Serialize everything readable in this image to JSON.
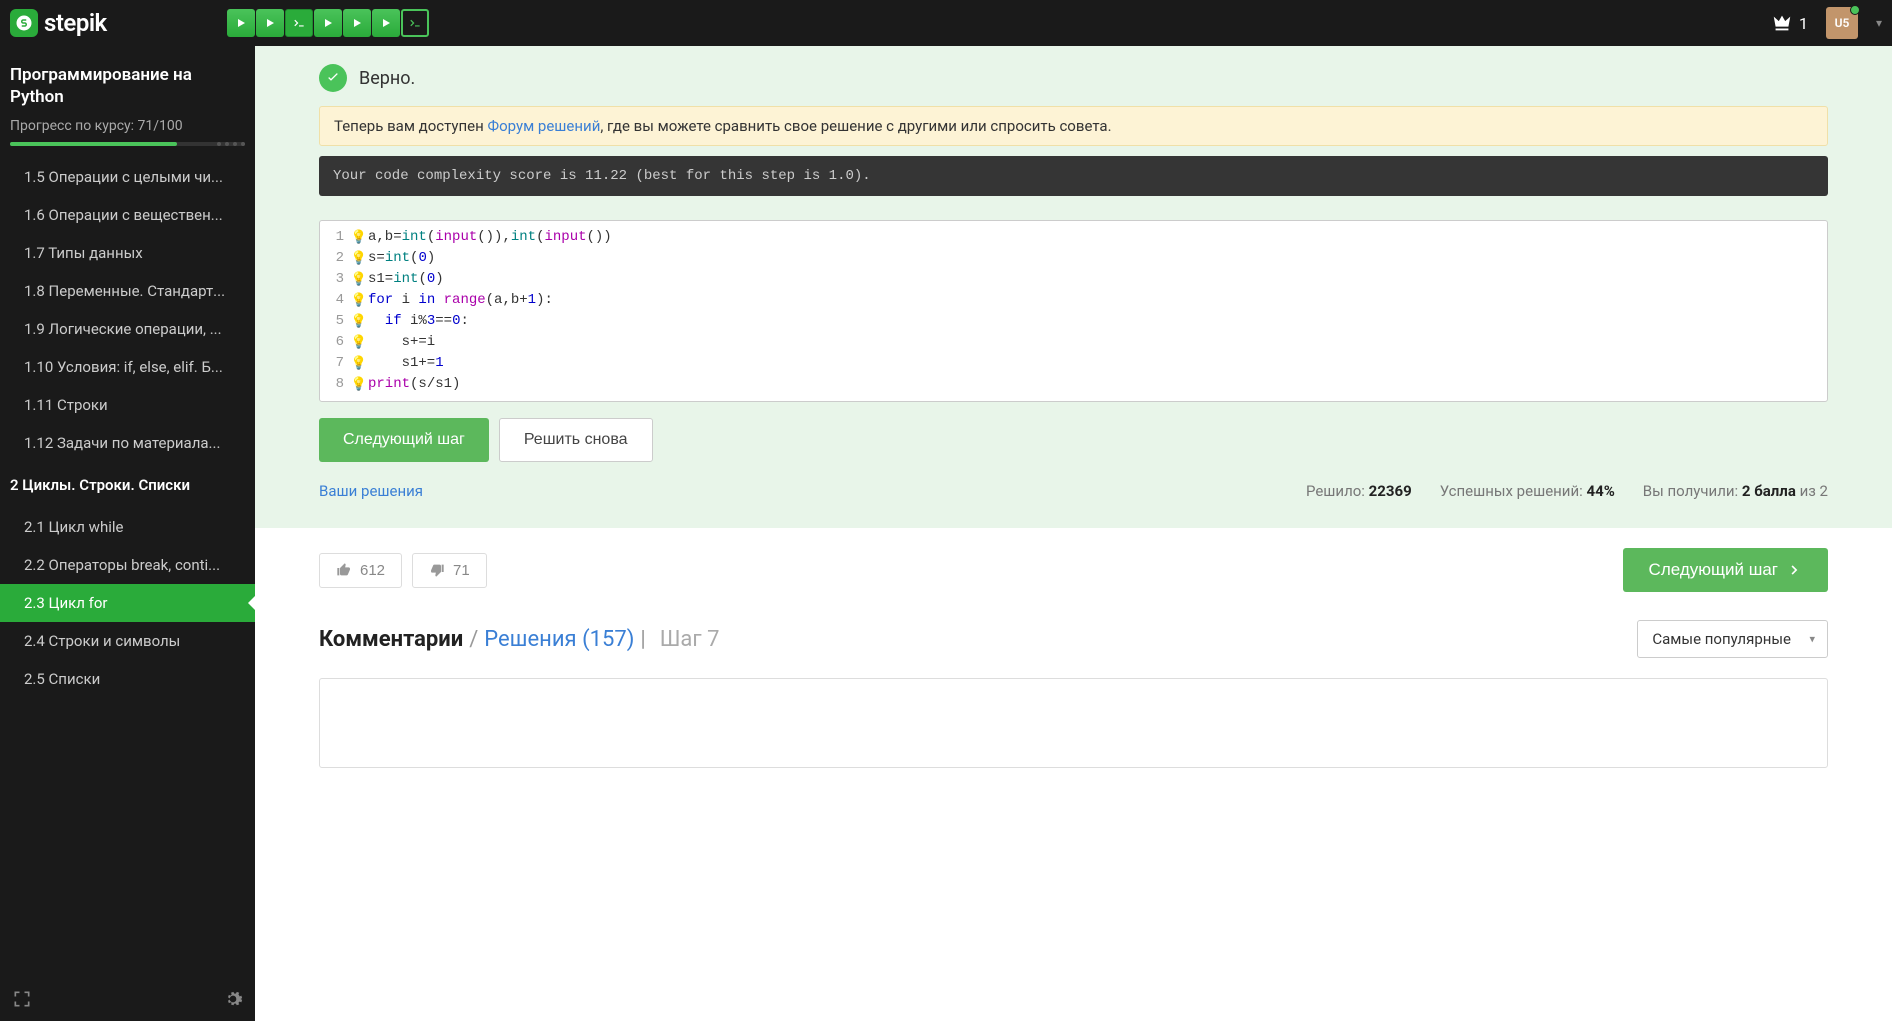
{
  "header": {
    "logo_text": "stepik",
    "crown_count": "1",
    "avatar_text": "U5",
    "steps": [
      {
        "type": "play"
      },
      {
        "type": "play"
      },
      {
        "type": "code"
      },
      {
        "type": "play"
      },
      {
        "type": "play"
      },
      {
        "type": "play"
      },
      {
        "type": "code-active"
      }
    ]
  },
  "sidebar": {
    "course_title": "Программирование на Python",
    "progress_label": "Прогресс по курсу:  71/100",
    "items1": [
      {
        "num": "1.5",
        "label": "Операции с целыми чи..."
      },
      {
        "num": "1.6",
        "label": "Операции с веществен..."
      },
      {
        "num": "1.7",
        "label": "Типы данных"
      },
      {
        "num": "1.8",
        "label": "Переменные. Стандарт..."
      },
      {
        "num": "1.9",
        "label": "Логические операции, ..."
      },
      {
        "num": "1.10",
        "label": "Условия: if, else, elif. Б..."
      },
      {
        "num": "1.11",
        "label": "Строки"
      },
      {
        "num": "1.12",
        "label": "Задачи по материала..."
      }
    ],
    "section2": "2  Циклы. Строки. Списки",
    "items2": [
      {
        "num": "2.1",
        "label": "Цикл while"
      },
      {
        "num": "2.2",
        "label": "Операторы break, conti..."
      },
      {
        "num": "2.3",
        "label": "Цикл for",
        "active": true
      },
      {
        "num": "2.4",
        "label": "Строки и символы"
      },
      {
        "num": "2.5",
        "label": "Списки"
      }
    ]
  },
  "main": {
    "correct": "Верно.",
    "forum_pre": "Теперь вам доступен ",
    "forum_link": "Форум решений",
    "forum_post": ", где вы можете сравнить свое решение с другими или спросить совета.",
    "complexity": "Your code complexity score is 11.22 (best for this step is 1.0).",
    "btn_next_step": "Следующий шаг",
    "btn_retry": "Решить снова",
    "your_solutions": "Ваши решения",
    "solved_label": "Решило: ",
    "solved_value": "22369",
    "success_label": "Успешных решений: ",
    "success_value": "44%",
    "points_label": "Вы получили: ",
    "points_value": "2 балла",
    "points_of": " из 2",
    "likes": "612",
    "dislikes": "71",
    "next_step_btn": "Следующий шаг",
    "comments_title": "Комментарии",
    "solutions_link": "Решения (157)",
    "step_tag": "Шаг 7",
    "sort_label": "Самые популярные"
  },
  "code": {
    "lines": [
      {
        "n": "1",
        "tokens": [
          {
            "t": "a,b="
          },
          {
            "t": "int",
            "c": "teal"
          },
          {
            "t": "("
          },
          {
            "t": "input",
            "c": "magenta"
          },
          {
            "t": "()),"
          },
          {
            "t": "int",
            "c": "teal"
          },
          {
            "t": "("
          },
          {
            "t": "input",
            "c": "magenta"
          },
          {
            "t": "())"
          }
        ]
      },
      {
        "n": "2",
        "tokens": [
          {
            "t": "s="
          },
          {
            "t": "int",
            "c": "teal"
          },
          {
            "t": "("
          },
          {
            "t": "0",
            "c": "blue"
          },
          {
            "t": ")"
          }
        ]
      },
      {
        "n": "3",
        "tokens": [
          {
            "t": "s1="
          },
          {
            "t": "int",
            "c": "teal"
          },
          {
            "t": "("
          },
          {
            "t": "0",
            "c": "blue"
          },
          {
            "t": ")"
          }
        ]
      },
      {
        "n": "4",
        "tokens": [
          {
            "t": "for ",
            "c": "blue"
          },
          {
            "t": "i "
          },
          {
            "t": "in ",
            "c": "blue"
          },
          {
            "t": "range",
            "c": "magenta"
          },
          {
            "t": "(a,b+"
          },
          {
            "t": "1",
            "c": "blue"
          },
          {
            "t": "):"
          }
        ]
      },
      {
        "n": "5",
        "tokens": [
          {
            "t": "  "
          },
          {
            "t": "if ",
            "c": "blue"
          },
          {
            "t": "i%"
          },
          {
            "t": "3",
            "c": "blue"
          },
          {
            "t": "=="
          },
          {
            "t": "0",
            "c": "blue"
          },
          {
            "t": ":"
          }
        ]
      },
      {
        "n": "6",
        "tokens": [
          {
            "t": "    s+=i"
          }
        ]
      },
      {
        "n": "7",
        "tokens": [
          {
            "t": "    s1+="
          },
          {
            "t": "1",
            "c": "blue"
          }
        ]
      },
      {
        "n": "8",
        "tokens": [
          {
            "t": "print",
            "c": "magenta"
          },
          {
            "t": "(s/s1)"
          }
        ]
      }
    ]
  }
}
